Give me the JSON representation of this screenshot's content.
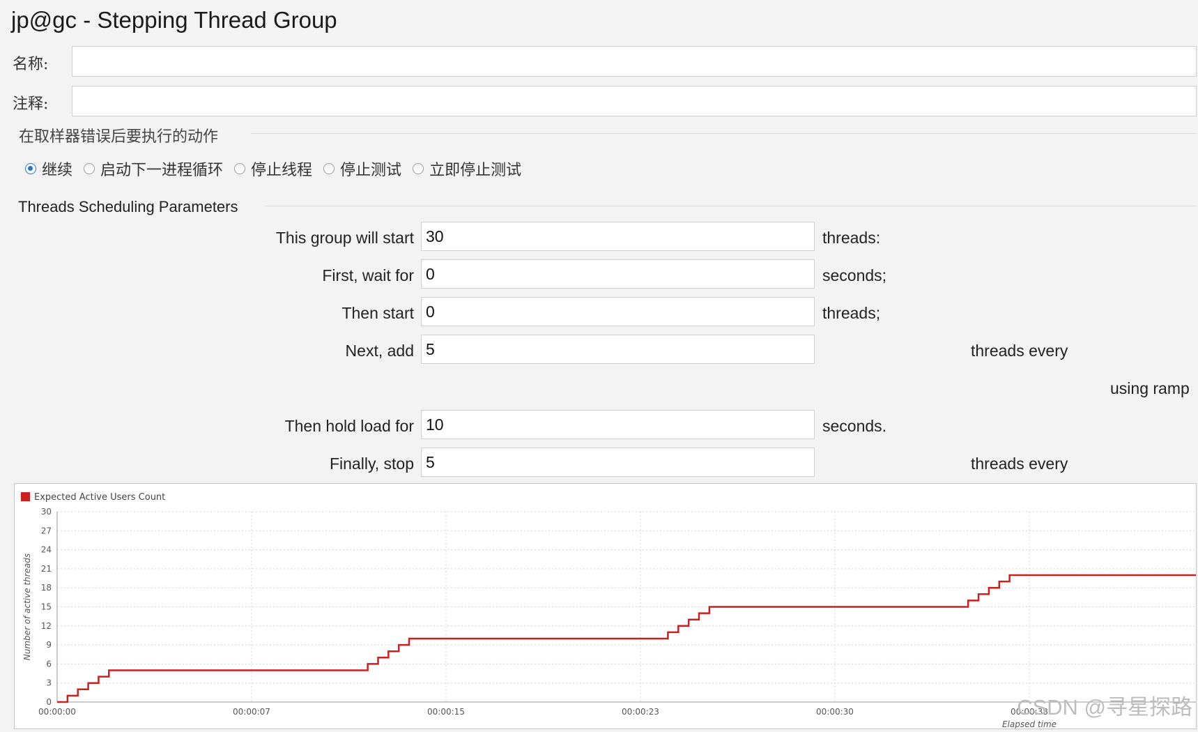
{
  "window": {
    "title": "jp@gc - Stepping Thread Group"
  },
  "form": {
    "name_label": "名称:",
    "name_value": "",
    "comment_label": "注释:",
    "comment_value": ""
  },
  "error_action": {
    "heading": "在取样器错误后要执行的动作",
    "options": [
      {
        "label": "继续",
        "selected": true
      },
      {
        "label": "启动下一进程循环",
        "selected": false
      },
      {
        "label": "停止线程",
        "selected": false
      },
      {
        "label": "停止测试",
        "selected": false
      },
      {
        "label": "立即停止测试",
        "selected": false
      }
    ]
  },
  "threads": {
    "heading": "Threads Scheduling Parameters",
    "rows": [
      {
        "label": "This group will start",
        "value": "30",
        "suffix": "threads:"
      },
      {
        "label": "First, wait for",
        "value": "0",
        "suffix": "seconds;"
      },
      {
        "label": "Then start",
        "value": "0",
        "suffix": "threads;"
      },
      {
        "label": "Next, add",
        "value": "5",
        "suffix": "threads every"
      },
      {
        "label": "Then hold load for",
        "value": "10",
        "suffix": "seconds."
      },
      {
        "label": "Finally, stop",
        "value": "5",
        "suffix": "threads every"
      }
    ],
    "ramp_text": "using ramp"
  },
  "chart_data": {
    "type": "line",
    "legend": "Expected Active Users Count",
    "ylabel": "Number of active threads",
    "xlabel": "Elapsed time",
    "ylim": [
      0,
      30
    ],
    "yticks": [
      "0",
      "3",
      "6",
      "9",
      "12",
      "15",
      "18",
      "21",
      "24",
      "27",
      "30"
    ],
    "xticks": [
      "00:00:00",
      "00:00:07",
      "00:00:15",
      "00:00:23",
      "00:00:30",
      "00:00:38"
    ],
    "xlim_seconds": [
      0,
      44
    ],
    "series": [
      {
        "name": "Expected Active Users Count",
        "color": "#cc1f1f",
        "points": [
          [
            0,
            0
          ],
          [
            0.4,
            1
          ],
          [
            0.8,
            2
          ],
          [
            1.2,
            3
          ],
          [
            1.6,
            4
          ],
          [
            2.0,
            5
          ],
          [
            11.6,
            5
          ],
          [
            12.0,
            6
          ],
          [
            12.4,
            7
          ],
          [
            12.8,
            8
          ],
          [
            13.2,
            9
          ],
          [
            13.6,
            10
          ],
          [
            23.2,
            10
          ],
          [
            23.6,
            11
          ],
          [
            24.0,
            12
          ],
          [
            24.4,
            13
          ],
          [
            24.8,
            14
          ],
          [
            25.2,
            15
          ],
          [
            34.8,
            15
          ],
          [
            35.2,
            16
          ],
          [
            35.6,
            17
          ],
          [
            36.0,
            18
          ],
          [
            36.4,
            19
          ],
          [
            36.8,
            20
          ],
          [
            44,
            20
          ]
        ]
      }
    ]
  },
  "watermark": "CSDN @寻星探路"
}
